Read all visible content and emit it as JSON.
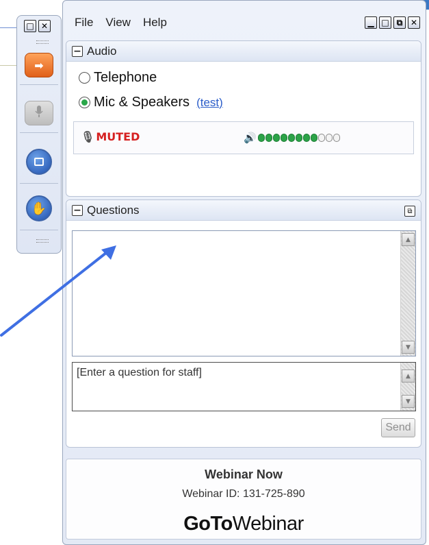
{
  "menu": {
    "file": "File",
    "view": "View",
    "help": "Help"
  },
  "control_panel": {
    "icons": [
      "arrow-right-icon",
      "microphone-icon",
      "screen-share-icon",
      "raise-hand-icon"
    ]
  },
  "window_buttons": {
    "minimize": "▁",
    "maximize": "□",
    "restore": "⧉",
    "close": "✕"
  },
  "audio": {
    "title": "Audio",
    "collapse_symbol": "−",
    "option_telephone": "Telephone",
    "option_mic": "Mic & Speakers",
    "selected": "Mic & Speakers",
    "test_link": "(test)",
    "status": "MUTED",
    "level_total": 11,
    "level_active": 8,
    "colors": {
      "muted": "#d62020",
      "level_on": "#2ca348"
    }
  },
  "questions": {
    "title": "Questions",
    "collapse_symbol": "−",
    "input_placeholder": "[Enter a question for staff]",
    "send_label": "Send"
  },
  "footer": {
    "webinar_name": "Webinar Now",
    "webinar_id": "Webinar ID: 131-725-890",
    "logo_bold_go": "Go",
    "logo_bold_to": "To",
    "logo_rest": "Webinar"
  },
  "annotation": {
    "arrow_color": "#3f6fe3"
  }
}
